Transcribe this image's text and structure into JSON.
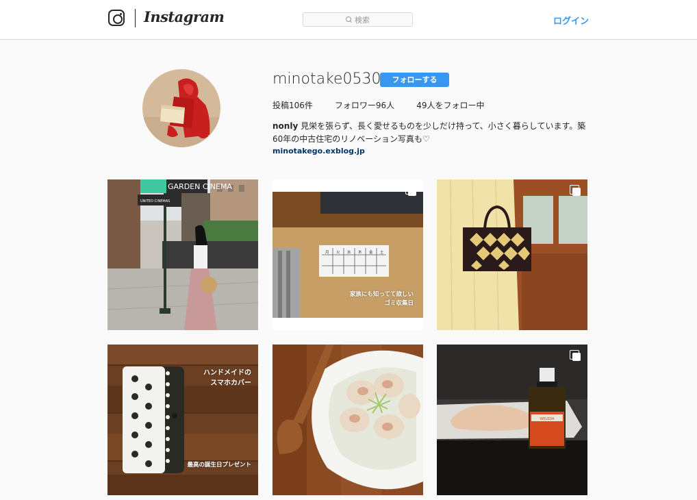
{
  "header": {
    "wordmark": "Instagram",
    "search_placeholder": "検索",
    "login_label": "ログイン"
  },
  "profile": {
    "username": "minotake0530",
    "follow_label": "フォローする",
    "stats": {
      "posts": "投稿106件",
      "followers": "フォロワー96人",
      "following": "49人をフォロー中"
    },
    "bio_name": "nonly",
    "bio_text": " 見栄を張らず、長く愛せるものを少しだけ持って、小さく暮らしています。築60年の中古住宅のリノベーション写真も♡",
    "link": "minotakego.exblog.jp"
  },
  "posts": [
    {
      "overlay_lines": [],
      "sign_text": "GARDEN CINEMA",
      "sign_sub": "UNITED CINEMAS"
    },
    {
      "overlay_lines": [
        "家族にも知ってて欲しい",
        "ゴミ収集日"
      ],
      "multi": true,
      "table_heads": [
        "月",
        "火",
        "水",
        "木",
        "金",
        "土"
      ]
    },
    {
      "overlay_lines": [],
      "multi": true
    },
    {
      "overlay_lines": [
        "ハンドメイドの",
        "スマホカバー"
      ],
      "overlay_bottom": "最高の誕生日プレゼント"
    },
    {
      "overlay_lines": []
    },
    {
      "overlay_lines": [],
      "multi": true,
      "bottle_label": "WELEDA"
    }
  ],
  "colors": {
    "accent": "#3897f0",
    "link": "#003569",
    "border": "#dbdbdb",
    "background": "#fafafa"
  }
}
